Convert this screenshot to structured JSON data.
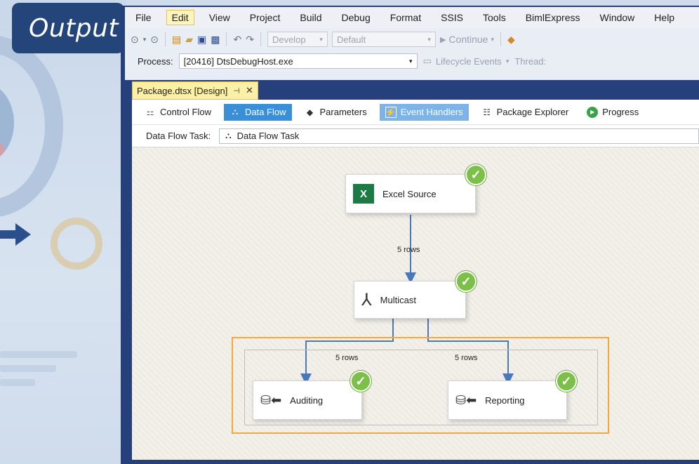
{
  "badge": {
    "title": "Output"
  },
  "menu": [
    "File",
    "Edit",
    "View",
    "Project",
    "Build",
    "Debug",
    "Format",
    "SSIS",
    "Tools",
    "BimlExpress",
    "Window",
    "Help"
  ],
  "toolbar": {
    "config_combo": "Develop",
    "platform_combo": "Default",
    "continue_label": "Continue"
  },
  "process_bar": {
    "label": "Process:",
    "value": "[20416] DtsDebugHost.exe",
    "lifecycle_label": "Lifecycle Events",
    "thread_label": "Thread:"
  },
  "doc_tab": {
    "title": "Package.dtsx [Design]"
  },
  "designer_tabs": {
    "control_flow": "Control Flow",
    "data_flow": "Data Flow",
    "parameters": "Parameters",
    "event_handlers": "Event Handlers",
    "package_explorer": "Package Explorer",
    "progress": "Progress"
  },
  "data_flow_task": {
    "label": "Data Flow Task:",
    "value": "Data Flow Task"
  },
  "nodes": {
    "excel_source": "Excel Source",
    "multicast": "Multicast",
    "auditing": "Auditing",
    "reporting": "Reporting"
  },
  "flows": {
    "excel_to_multicast": "5 rows",
    "multicast_to_auditing": "5 rows",
    "multicast_to_reporting": "5 rows"
  },
  "colors": {
    "accent_blue": "#3a8fd9",
    "frame_navy": "#25407a",
    "success_green": "#7cc04a",
    "selection_orange": "#f4a83a"
  }
}
